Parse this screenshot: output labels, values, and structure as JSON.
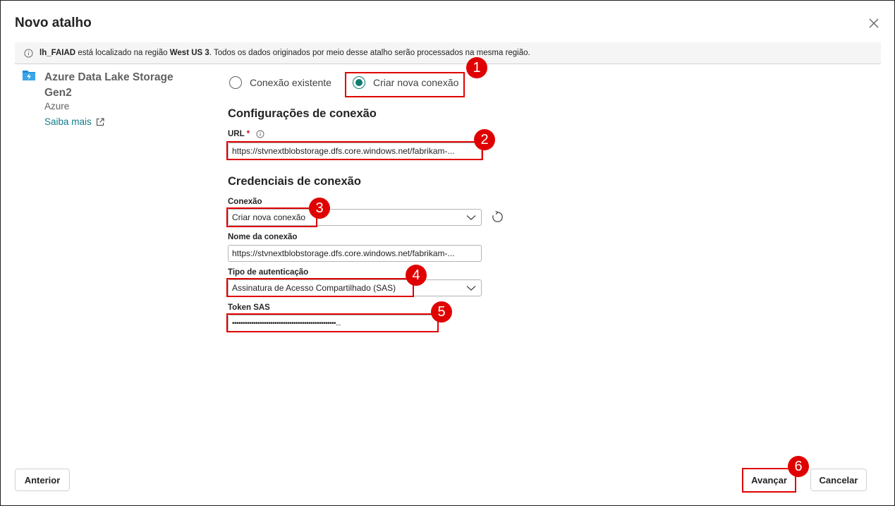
{
  "dialog": {
    "title": "Novo atalho"
  },
  "banner": {
    "lakehouse": "lh_FAIAD",
    "text1": " está localizado na região ",
    "region": "West US 3",
    "text2": ". Todos os dados originados por meio desse atalho serão processados na mesma região."
  },
  "source": {
    "name": "Azure Data Lake Storage Gen2",
    "provider": "Azure",
    "learn_more": "Saiba mais",
    "icon": "adls-storage-icon"
  },
  "connection_mode": {
    "options": [
      "Conexão existente",
      "Criar nova conexão"
    ],
    "selected": "Criar nova conexão"
  },
  "connection_settings": {
    "heading": "Configurações de conexão",
    "url_label": "URL",
    "url_required": "*",
    "url_value": "https://stvnextblobstorage.dfs.core.windows.net/fabrikam-..."
  },
  "credentials": {
    "heading": "Credenciais de conexão",
    "connection_label": "Conexão",
    "connection_value": "Criar nova conexão",
    "connection_name_label": "Nome da conexão",
    "connection_name_value": "https://stvnextblobstorage.dfs.core.windows.net/fabrikam-...",
    "auth_type_label": "Tipo de autenticação",
    "auth_type_value": "Assinatura de Acesso Compartilhado (SAS)",
    "sas_label": "Token SAS",
    "sas_value": "•••••••••••••••••••••••••••••••••••••••••••••••••..."
  },
  "annotations": [
    "1",
    "2",
    "3",
    "4",
    "5",
    "6"
  ],
  "footer": {
    "back": "Anterior",
    "next": "Avançar",
    "cancel": "Cancelar"
  },
  "colors": {
    "accent": "#107c6f",
    "highlight": "#e00000",
    "link": "#107c8c"
  }
}
